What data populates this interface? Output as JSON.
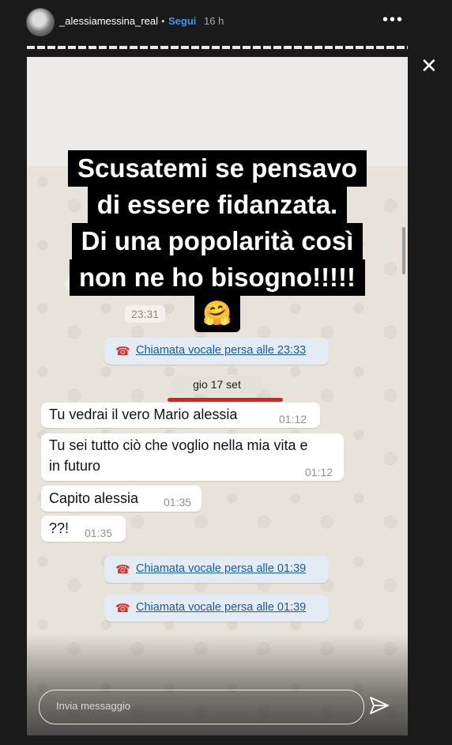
{
  "header": {
    "username": "_alessiamessina_real",
    "separator": "•",
    "follow_label": "Segui",
    "time": "16 h",
    "more_icon": "more-horizontal-icon",
    "close_icon": "close-icon"
  },
  "caption": {
    "lines": [
      "Scusatemi se pensavo",
      "di essere fidanzata.",
      "Di una popolarità così",
      "non ne ho bisogno!!!!!"
    ],
    "emoji": "🤗"
  },
  "chat": {
    "first_time": "23:31",
    "calls": [
      {
        "text": "Chiamata vocale persa alle 23:33"
      },
      {
        "text": "Chiamata vocale persa alle 01:39"
      },
      {
        "text": "Chiamata vocale persa alle 01:39"
      }
    ],
    "date_chip": "gio 17 set",
    "messages": [
      {
        "text": "Tu vedrai il vero Mario alessia",
        "time": "01:12"
      },
      {
        "text": "Tu sei tutto ciò che voglio nella mia vita e",
        "text2": "in futuro",
        "time": "01:12"
      },
      {
        "text": "Capito alessia",
        "time": "01:35"
      },
      {
        "text": "??!",
        "time": "01:35"
      }
    ]
  },
  "reply": {
    "placeholder": "Invia messaggio",
    "send_icon": "send-icon"
  },
  "colors": {
    "follow": "#3897f0",
    "missed_call": "#d93131",
    "link": "#1c5b95",
    "underline": "#d8222a"
  }
}
